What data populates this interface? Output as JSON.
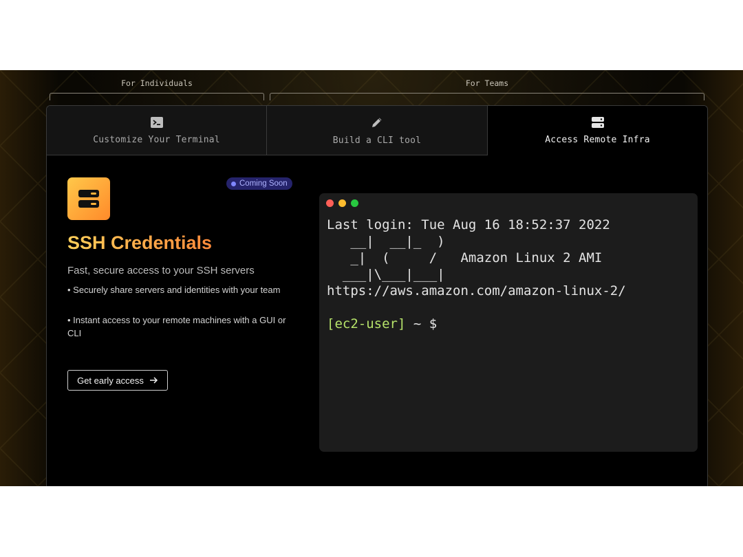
{
  "groups": {
    "individuals": "For Individuals",
    "teams": "For Teams"
  },
  "tabs": [
    {
      "label": "Customize Your Terminal",
      "icon": "terminal-icon",
      "active": false
    },
    {
      "label": "Build a CLI tool",
      "icon": "pencil-icon",
      "active": false
    },
    {
      "label": "Access Remote Infra",
      "icon": "server-icon",
      "active": true
    }
  ],
  "feature": {
    "icon": "server-icon",
    "badge": "Coming Soon",
    "title": "SSH Credentials",
    "subtitle": "Fast, secure access to your SSH servers",
    "bullets": [
      "• Securely share servers and identities with your team",
      "• Instant access to your remote machines with a GUI or CLI"
    ],
    "cta": "Get early access",
    "cta_icon": "arrow-right-icon"
  },
  "terminal": {
    "lines": [
      "Last login: Tue Aug 16 18:52:37 2022",
      "   __|  __|_  )",
      "   _|  (     /   Amazon Linux 2 AMI",
      "  ___|\\___|___|",
      "https://aws.amazon.com/amazon-linux-2/",
      ""
    ],
    "prompt_user": "[ec2-user]",
    "prompt_rest": " ~ $"
  },
  "colors": {
    "accent_start": "#ffc84a",
    "accent_end": "#ff8a2a",
    "badge_bg": "#25236b",
    "prompt_green": "#b6e36a",
    "traffic_red": "#ff5f57",
    "traffic_yellow": "#febc2e",
    "traffic_green": "#28c840"
  }
}
